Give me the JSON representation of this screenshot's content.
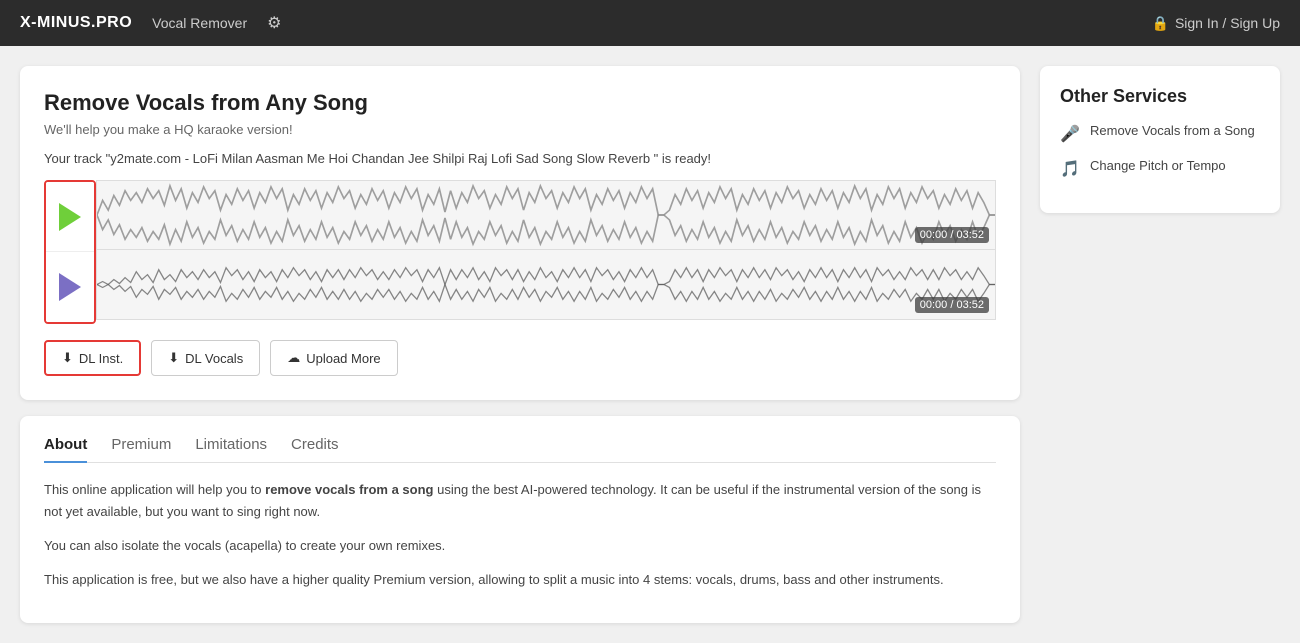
{
  "header": {
    "logo": "X-MINUS.PRO",
    "nav_label": "Vocal Remover",
    "gear_label": "⚙",
    "sign_in_label": "Sign In / Sign Up",
    "lock_icon": "🔒"
  },
  "main_card": {
    "title": "Remove Vocals from Any Song",
    "subtitle": "We'll help you make a HQ karaoke version!",
    "track_ready": "Your track \"y2mate.com - LoFi Milan Aasman Me Hoi Chandan Jee Shilpi Raj Lofi Sad Song Slow Reverb \" is ready!",
    "instrumental_time": "00:00 / 03:52",
    "vocals_time": "00:00 / 03:52",
    "buttons": {
      "dl_inst": "DL Inst.",
      "dl_vocals": "DL Vocals",
      "upload_more": "Upload More"
    }
  },
  "about_card": {
    "tabs": [
      "About",
      "Premium",
      "Limitations",
      "Credits"
    ],
    "active_tab": "About",
    "paragraphs": [
      "This online application will help you to remove vocals from a song using the best AI-powered technology. It can be useful if the instrumental version of the song is not yet available, but you want to sing right now.",
      "You can also isolate the vocals (acapella) to create your own remixes.",
      "This application is free, but we also have a higher quality Premium version, allowing to split a music into 4 stems: vocals, drums, bass and other instruments."
    ],
    "bold_phrase": "remove vocals from a song"
  },
  "sidebar": {
    "title": "Other Services",
    "items": [
      {
        "icon": "🎤",
        "label": "Remove Vocals from a Song"
      },
      {
        "icon": "🎵",
        "label": "Change Pitch or Tempo"
      }
    ]
  }
}
